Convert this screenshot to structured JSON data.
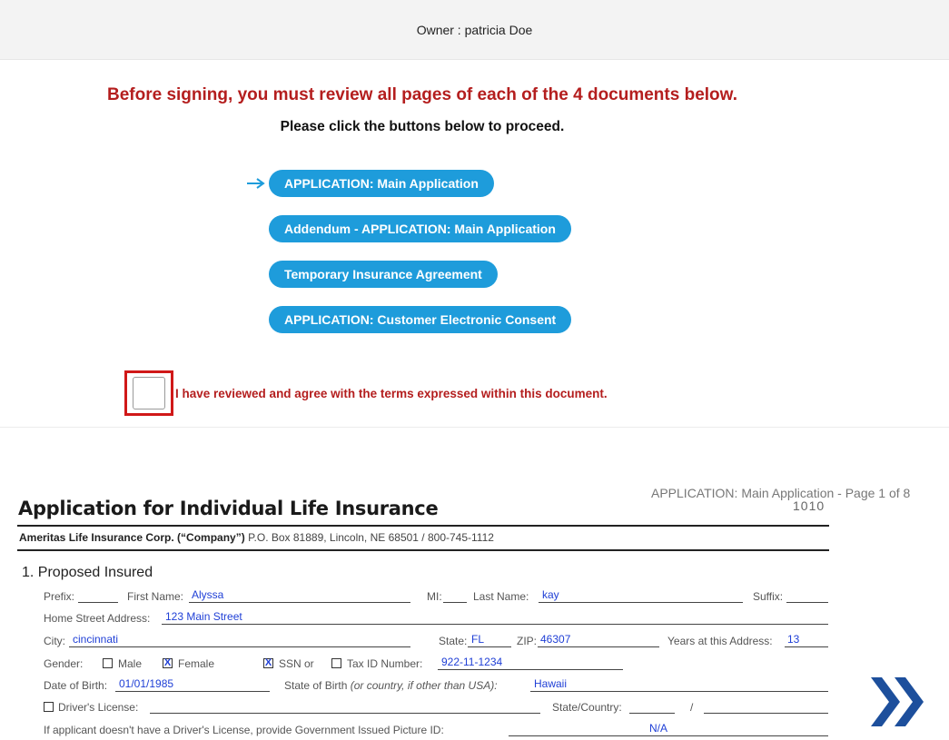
{
  "owner": {
    "text": "Owner : patricia Doe"
  },
  "review": {
    "title": "Before signing, you must review all pages of each of the 4 documents below.",
    "subtitle": "Please click the buttons below to proceed.",
    "buttons": [
      "APPLICATION: Main Application",
      "Addendum - APPLICATION: Main Application",
      "Temporary Insurance Agreement",
      "APPLICATION: Customer Electronic Consent"
    ],
    "agree_text": "I have reviewed and agree with the terms expressed within this document."
  },
  "doc": {
    "page_label": "APPLICATION: Main Application - Page 1 of 8",
    "form_code": "1010",
    "title": "Application for Individual Life Insurance",
    "company_name": "Ameritas Life Insurance Corp. (“Company”)",
    "company_address": "P.O. Box 81889, Lincoln, NE 68501 / 800-745-1112",
    "section": "1.  Proposed Insured",
    "labels": {
      "prefix": "Prefix:",
      "first_name": "First Name:",
      "mi": "MI:",
      "last_name": "Last Name:",
      "suffix": "Suffix:",
      "home_address": "Home Street Address:",
      "city": "City:",
      "state": "State:",
      "zip": "ZIP:",
      "years": "Years at this Address:",
      "gender": "Gender:",
      "male": "Male",
      "female": "Female",
      "ssn": "SSN  or",
      "tax_id": "Tax ID Number:",
      "dob": "Date of Birth:",
      "state_of_birth": "State of Birth",
      "state_of_birth_note": "(or country, if other than USA):",
      "drivers_license": "Driver's License:",
      "state_country": "State/Country:",
      "slash": "/",
      "gov_id": "If applicant doesn't have a Driver's License, provide Government Issued Picture ID:"
    },
    "values": {
      "first_name": "Alyssa",
      "last_name": "kay",
      "home_address": "123 Main Street",
      "city": "cincinnati",
      "state": "FL",
      "zip": "46307",
      "years": "13",
      "gender_female_mark": "X",
      "ssn_mark": "X",
      "tax_id": "922-11-1234",
      "dob": "01/01/1985",
      "state_of_birth": "Hawaii",
      "gov_id": "N/A"
    }
  },
  "colors": {
    "accent": "#1e9cdb",
    "warning": "#b41e1e",
    "field_value": "#1f3fd6",
    "next_arrow": "#1d4f9c"
  },
  "icons": {
    "arrow": "right-arrow-icon",
    "next": "double-chevron-right-icon"
  }
}
